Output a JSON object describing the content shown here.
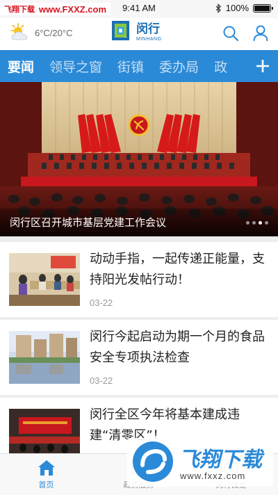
{
  "status_bar": {
    "watermark_cn": "飞翔下载",
    "watermark_url": "www.FXXZ.com",
    "time": "9:41 AM",
    "battery_percent": "100%",
    "battery_level": 1.0
  },
  "header": {
    "weather": "6°C/20°C",
    "logo_cn": "闵行",
    "logo_en": "MINHANG",
    "weather_icon": "sun-cloud-icon",
    "search_icon": "search-icon",
    "profile_icon": "user-icon"
  },
  "tabs": [
    {
      "label": "要闻",
      "active": true
    },
    {
      "label": "领导之窗",
      "active": false
    },
    {
      "label": "街镇",
      "active": false
    },
    {
      "label": "委办局",
      "active": false
    },
    {
      "label": "政",
      "active": false
    }
  ],
  "hero": {
    "caption": "闵行区召开城市基层党建工作会议",
    "slides": 4,
    "active_slide": 2
  },
  "news": [
    {
      "title": "动动手指，一起传递正能量，支持阳光发帖行动！",
      "date": "03-22"
    },
    {
      "title": "闵行今起启动为期一个月的食品安全专项执法检查",
      "date": "03-22"
    },
    {
      "title": "闵行全区今年将基本建成违建“清零区”！",
      "date": ""
    }
  ],
  "bottom_nav": [
    {
      "label": "首页",
      "icon": "home-icon",
      "active": true
    },
    {
      "label": "政务服务",
      "icon": "service-icon",
      "active": false
    },
    {
      "label": "闵行微览",
      "icon": "browse-icon",
      "active": false
    }
  ],
  "watermark": {
    "title": "飞翔下载",
    "url": "www.fxxz.com"
  },
  "colors": {
    "accent": "#2b8ad8",
    "party_red": "#c8171e"
  }
}
